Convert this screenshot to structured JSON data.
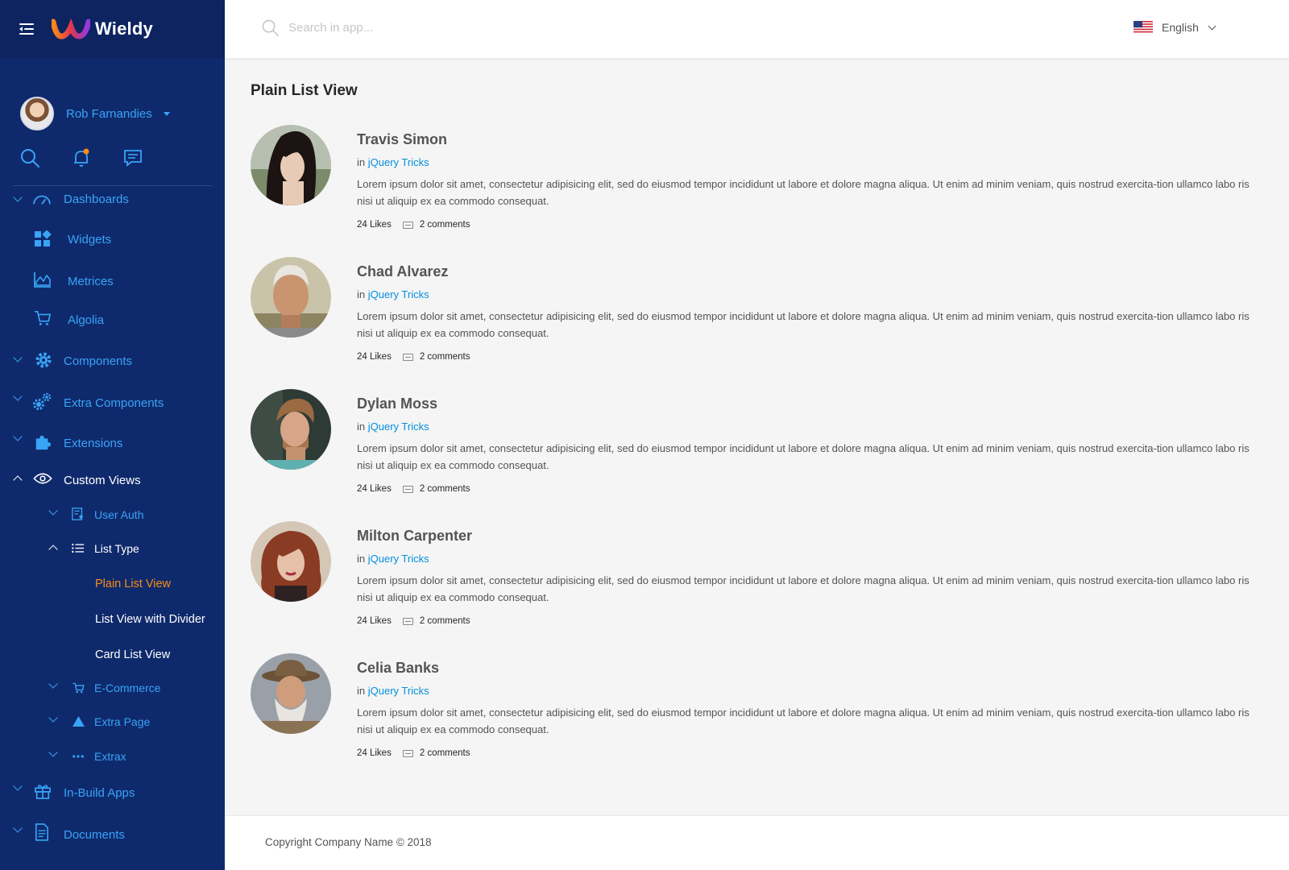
{
  "brand": {
    "name": "Wieldy"
  },
  "user": {
    "name": "Rob Farnandies"
  },
  "header": {
    "search_placeholder": "Search in app...",
    "language": "English"
  },
  "sidebar": {
    "items": [
      {
        "label": "Dashboards"
      },
      {
        "label": "Widgets"
      },
      {
        "label": "Metrices"
      },
      {
        "label": "Algolia"
      },
      {
        "label": "Components"
      },
      {
        "label": "Extra Components"
      },
      {
        "label": "Extensions"
      },
      {
        "label": "Custom Views"
      },
      {
        "label": "User Auth"
      },
      {
        "label": "List Type"
      },
      {
        "label": "Plain List View"
      },
      {
        "label": "List View with Divider"
      },
      {
        "label": "Card List View"
      },
      {
        "label": "E-Commerce"
      },
      {
        "label": "Extra Page"
      },
      {
        "label": "Extrax"
      },
      {
        "label": "In-Build Apps"
      },
      {
        "label": "Documents"
      }
    ]
  },
  "main": {
    "title": "Plain List View",
    "items": [
      {
        "name": "Travis Simon",
        "in": "in",
        "category": "jQuery Tricks",
        "description": "Lorem ipsum dolor sit amet, consectetur adipisicing elit, sed do eiusmod tempor incididunt ut labore et dolore magna aliqua. Ut enim ad minim veniam, quis nostrud exercita-tion ullamco labo ris nisi ut aliquip ex ea commodo consequat.",
        "likes": "24 Likes",
        "comments": "2 comments"
      },
      {
        "name": "Chad Alvarez",
        "in": "in",
        "category": "jQuery Tricks",
        "description": "Lorem ipsum dolor sit amet, consectetur adipisicing elit, sed do eiusmod tempor incididunt ut labore et dolore magna aliqua. Ut enim ad minim veniam, quis nostrud exercita-tion ullamco labo ris nisi ut aliquip ex ea commodo consequat.",
        "likes": "24 Likes",
        "comments": "2 comments"
      },
      {
        "name": "Dylan Moss",
        "in": "in",
        "category": "jQuery Tricks",
        "description": "Lorem ipsum dolor sit amet, consectetur adipisicing elit, sed do eiusmod tempor incididunt ut labore et dolore magna aliqua. Ut enim ad minim veniam, quis nostrud exercita-tion ullamco labo ris nisi ut aliquip ex ea commodo consequat.",
        "likes": "24 Likes",
        "comments": "2 comments"
      },
      {
        "name": "Milton Carpenter",
        "in": "in",
        "category": "jQuery Tricks",
        "description": "Lorem ipsum dolor sit amet, consectetur adipisicing elit, sed do eiusmod tempor incididunt ut labore et dolore magna aliqua. Ut enim ad minim veniam, quis nostrud exercita-tion ullamco labo ris nisi ut aliquip ex ea commodo consequat.",
        "likes": "24 Likes",
        "comments": "2 comments"
      },
      {
        "name": "Celia Banks",
        "in": "in",
        "category": "jQuery Tricks",
        "description": "Lorem ipsum dolor sit amet, consectetur adipisicing elit, sed do eiusmod tempor incididunt ut labore et dolore magna aliqua. Ut enim ad minim veniam, quis nostrud exercita-tion ullamco labo ris nisi ut aliquip ex ea commodo consequat.",
        "likes": "24 Likes",
        "comments": "2 comments"
      }
    ]
  },
  "footer": {
    "copyright": "Copyright Company Name © 2018"
  },
  "colors": {
    "sidebar": "#0f2a6c",
    "sidebar_top": "#0d2461",
    "accent": "#038fde",
    "sidebar_text": "#38a4f8",
    "active": "#fa8c16",
    "background": "#f5f5f5"
  }
}
